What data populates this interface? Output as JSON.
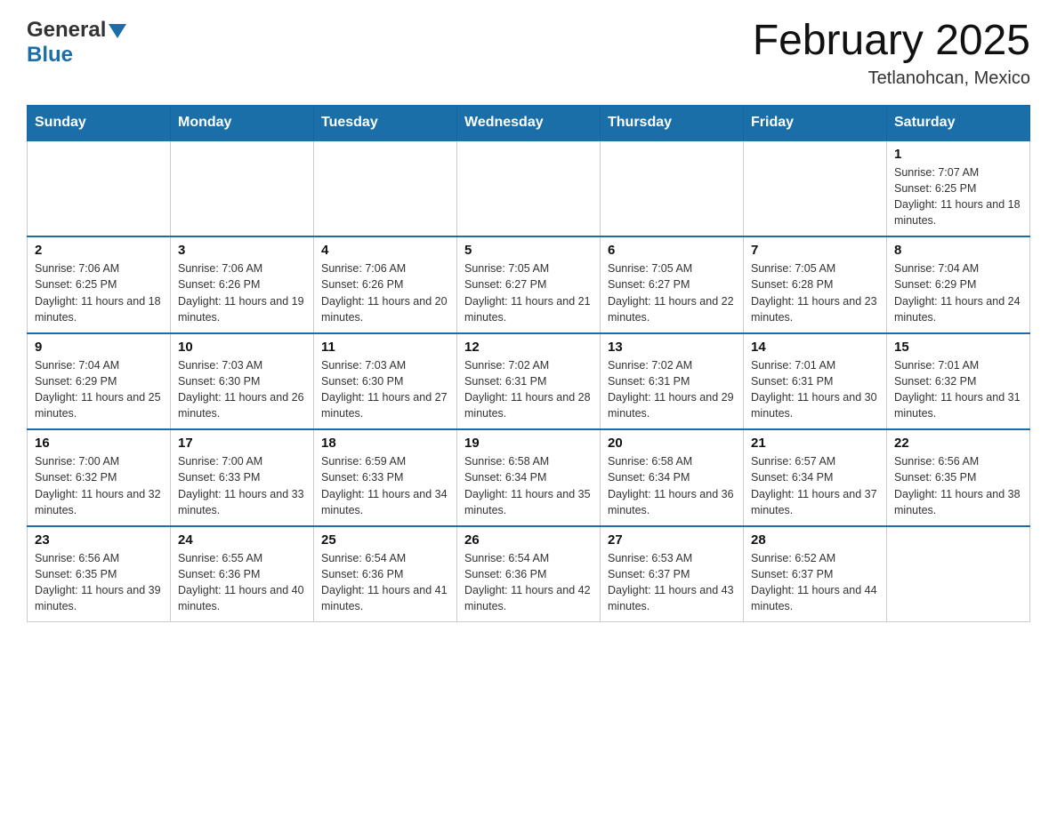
{
  "header": {
    "logo_general": "General",
    "logo_blue": "Blue",
    "title": "February 2025",
    "location": "Tetlanohcan, Mexico"
  },
  "days_of_week": [
    "Sunday",
    "Monday",
    "Tuesday",
    "Wednesday",
    "Thursday",
    "Friday",
    "Saturday"
  ],
  "weeks": [
    [
      {
        "day": "",
        "info": ""
      },
      {
        "day": "",
        "info": ""
      },
      {
        "day": "",
        "info": ""
      },
      {
        "day": "",
        "info": ""
      },
      {
        "day": "",
        "info": ""
      },
      {
        "day": "",
        "info": ""
      },
      {
        "day": "1",
        "info": "Sunrise: 7:07 AM\nSunset: 6:25 PM\nDaylight: 11 hours and 18 minutes."
      }
    ],
    [
      {
        "day": "2",
        "info": "Sunrise: 7:06 AM\nSunset: 6:25 PM\nDaylight: 11 hours and 18 minutes."
      },
      {
        "day": "3",
        "info": "Sunrise: 7:06 AM\nSunset: 6:26 PM\nDaylight: 11 hours and 19 minutes."
      },
      {
        "day": "4",
        "info": "Sunrise: 7:06 AM\nSunset: 6:26 PM\nDaylight: 11 hours and 20 minutes."
      },
      {
        "day": "5",
        "info": "Sunrise: 7:05 AM\nSunset: 6:27 PM\nDaylight: 11 hours and 21 minutes."
      },
      {
        "day": "6",
        "info": "Sunrise: 7:05 AM\nSunset: 6:27 PM\nDaylight: 11 hours and 22 minutes."
      },
      {
        "day": "7",
        "info": "Sunrise: 7:05 AM\nSunset: 6:28 PM\nDaylight: 11 hours and 23 minutes."
      },
      {
        "day": "8",
        "info": "Sunrise: 7:04 AM\nSunset: 6:29 PM\nDaylight: 11 hours and 24 minutes."
      }
    ],
    [
      {
        "day": "9",
        "info": "Sunrise: 7:04 AM\nSunset: 6:29 PM\nDaylight: 11 hours and 25 minutes."
      },
      {
        "day": "10",
        "info": "Sunrise: 7:03 AM\nSunset: 6:30 PM\nDaylight: 11 hours and 26 minutes."
      },
      {
        "day": "11",
        "info": "Sunrise: 7:03 AM\nSunset: 6:30 PM\nDaylight: 11 hours and 27 minutes."
      },
      {
        "day": "12",
        "info": "Sunrise: 7:02 AM\nSunset: 6:31 PM\nDaylight: 11 hours and 28 minutes."
      },
      {
        "day": "13",
        "info": "Sunrise: 7:02 AM\nSunset: 6:31 PM\nDaylight: 11 hours and 29 minutes."
      },
      {
        "day": "14",
        "info": "Sunrise: 7:01 AM\nSunset: 6:31 PM\nDaylight: 11 hours and 30 minutes."
      },
      {
        "day": "15",
        "info": "Sunrise: 7:01 AM\nSunset: 6:32 PM\nDaylight: 11 hours and 31 minutes."
      }
    ],
    [
      {
        "day": "16",
        "info": "Sunrise: 7:00 AM\nSunset: 6:32 PM\nDaylight: 11 hours and 32 minutes."
      },
      {
        "day": "17",
        "info": "Sunrise: 7:00 AM\nSunset: 6:33 PM\nDaylight: 11 hours and 33 minutes."
      },
      {
        "day": "18",
        "info": "Sunrise: 6:59 AM\nSunset: 6:33 PM\nDaylight: 11 hours and 34 minutes."
      },
      {
        "day": "19",
        "info": "Sunrise: 6:58 AM\nSunset: 6:34 PM\nDaylight: 11 hours and 35 minutes."
      },
      {
        "day": "20",
        "info": "Sunrise: 6:58 AM\nSunset: 6:34 PM\nDaylight: 11 hours and 36 minutes."
      },
      {
        "day": "21",
        "info": "Sunrise: 6:57 AM\nSunset: 6:34 PM\nDaylight: 11 hours and 37 minutes."
      },
      {
        "day": "22",
        "info": "Sunrise: 6:56 AM\nSunset: 6:35 PM\nDaylight: 11 hours and 38 minutes."
      }
    ],
    [
      {
        "day": "23",
        "info": "Sunrise: 6:56 AM\nSunset: 6:35 PM\nDaylight: 11 hours and 39 minutes."
      },
      {
        "day": "24",
        "info": "Sunrise: 6:55 AM\nSunset: 6:36 PM\nDaylight: 11 hours and 40 minutes."
      },
      {
        "day": "25",
        "info": "Sunrise: 6:54 AM\nSunset: 6:36 PM\nDaylight: 11 hours and 41 minutes."
      },
      {
        "day": "26",
        "info": "Sunrise: 6:54 AM\nSunset: 6:36 PM\nDaylight: 11 hours and 42 minutes."
      },
      {
        "day": "27",
        "info": "Sunrise: 6:53 AM\nSunset: 6:37 PM\nDaylight: 11 hours and 43 minutes."
      },
      {
        "day": "28",
        "info": "Sunrise: 6:52 AM\nSunset: 6:37 PM\nDaylight: 11 hours and 44 minutes."
      },
      {
        "day": "",
        "info": ""
      }
    ]
  ]
}
